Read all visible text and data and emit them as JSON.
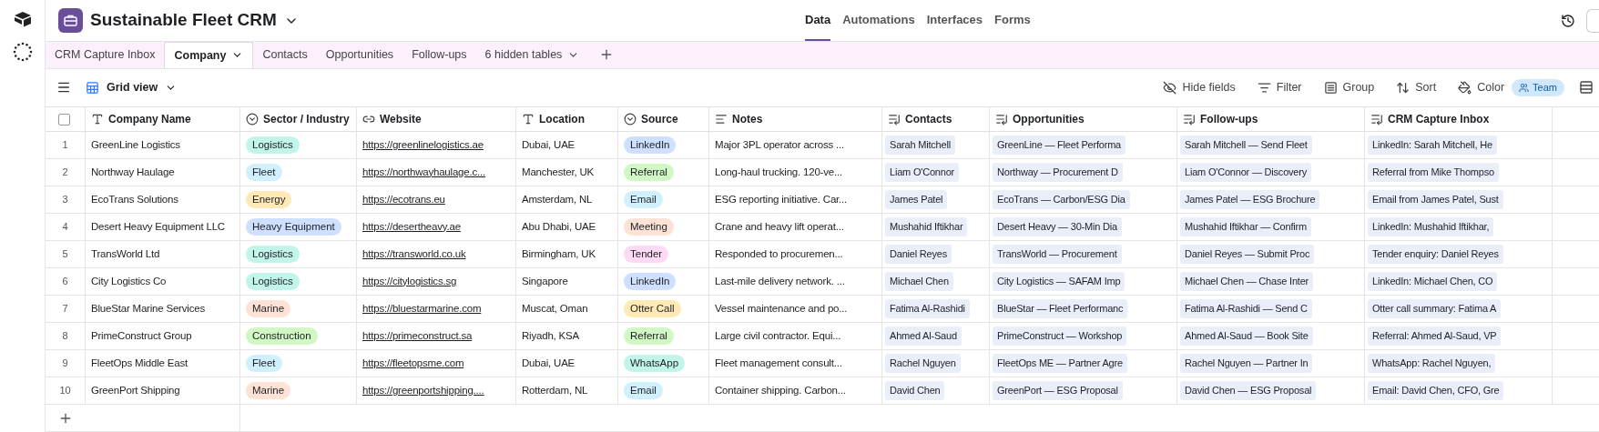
{
  "base": {
    "title": "Sustainable Fleet CRM"
  },
  "nav": [
    {
      "label": "Data",
      "selected": true
    },
    {
      "label": "Automations",
      "selected": false
    },
    {
      "label": "Interfaces",
      "selected": false
    },
    {
      "label": "Forms",
      "selected": false
    }
  ],
  "tables": [
    {
      "label": "CRM Capture Inbox",
      "selected": false
    },
    {
      "label": "Company",
      "selected": true
    },
    {
      "label": "Contacts",
      "selected": false
    },
    {
      "label": "Opportunities",
      "selected": false
    },
    {
      "label": "Follow-ups",
      "selected": false
    }
  ],
  "hidden_tables": "6 hidden tables",
  "view": {
    "name": "Grid view"
  },
  "select_all": {
    "checked": false
  },
  "toolbar": [
    {
      "label": "Hide fields",
      "kind": "hide"
    },
    {
      "label": "Filter",
      "kind": "filter"
    },
    {
      "label": "Group",
      "kind": "group"
    },
    {
      "label": "Sort",
      "kind": "sort"
    },
    {
      "label": "Color",
      "kind": "color",
      "badge": "Team"
    }
  ],
  "columns": [
    {
      "label": "Company Name",
      "kind": "text"
    },
    {
      "label": "Sector / Industry",
      "kind": "select"
    },
    {
      "label": "Website",
      "kind": "url"
    },
    {
      "label": "Location",
      "kind": "text"
    },
    {
      "label": "Source",
      "kind": "select"
    },
    {
      "label": "Notes",
      "kind": "longtext"
    },
    {
      "label": "Contacts",
      "kind": "link"
    },
    {
      "label": "Opportunities",
      "kind": "link"
    },
    {
      "label": "Follow-ups",
      "kind": "link"
    },
    {
      "label": "CRM Capture Inbox",
      "kind": "link"
    }
  ],
  "rows": [
    {
      "number": "1",
      "cells": [
        "GreenLine Logistics",
        {
          "label": "Logistics",
          "color": "#c2f5e9"
        },
        "https://greenlinelogistics.ae",
        "Dubai, UAE",
        {
          "label": "LinkedIn",
          "color": "#cfdfff"
        },
        "Major 3PL operator across ...",
        "Sarah Mitchell",
        "GreenLine — Fleet Performa",
        "Sarah Mitchell — Send Fleet",
        "LinkedIn: Sarah Mitchell, He"
      ]
    },
    {
      "number": "2",
      "cells": [
        "Northway Haulage",
        {
          "label": "Fleet",
          "color": "#d0f0fd"
        },
        "https://northwayhaulage.c...",
        "Manchester, UK",
        {
          "label": "Referral",
          "color": "#d1f7c4"
        },
        "Long-haul trucking. 120-ve...",
        "Liam O'Connor",
        "Northway — Procurement D",
        "Liam O'Connor — Discovery",
        "Referral from Mike Thompso"
      ]
    },
    {
      "number": "3",
      "cells": [
        "EcoTrans Solutions",
        {
          "label": "Energy",
          "color": "#ffeab6"
        },
        "https://ecotrans.eu",
        "Amsterdam, NL",
        {
          "label": "Email",
          "color": "#d0f0fd"
        },
        "ESG reporting initiative. Car...",
        "James Patel",
        "EcoTrans — Carbon/ESG Dia",
        "James Patel — ESG Brochure",
        "Email from James Patel, Sust"
      ]
    },
    {
      "number": "4",
      "cells": [
        "Desert Heavy Equipment LLC",
        {
          "label": "Heavy Equipment",
          "color": "#cfdfff"
        },
        "https://desertheavy.ae",
        "Abu Dhabi, UAE",
        {
          "label": "Meeting",
          "color": "#fee2d5"
        },
        "Crane and heavy lift operat...",
        "Mushahid Iftikhar",
        "Desert Heavy — 30-Min Dia",
        "Mushahid Iftikhar — Confirm",
        "LinkedIn: Mushahid Iftikhar,"
      ]
    },
    {
      "number": "5",
      "cells": [
        "TransWorld Ltd",
        {
          "label": "Logistics",
          "color": "#c2f5e9"
        },
        "https://transworld.co.uk",
        "Birmingham, UK",
        {
          "label": "Tender",
          "color": "#ffdaf6"
        },
        "Responded to procuremen...",
        "Daniel Reyes",
        "TransWorld — Procurement",
        "Daniel Reyes — Submit Proc",
        "Tender enquiry: Daniel Reyes"
      ]
    },
    {
      "number": "6",
      "cells": [
        "City Logistics Co",
        {
          "label": "Logistics",
          "color": "#c2f5e9"
        },
        "https://citylogistics.sg",
        "Singapore",
        {
          "label": "LinkedIn",
          "color": "#cfdfff"
        },
        "Last-mile delivery network. ...",
        "Michael Chen",
        "City Logistics — SAFAM Imp",
        "Michael Chen — Chase Inter",
        "LinkedIn: Michael Chen, CO"
      ]
    },
    {
      "number": "7",
      "cells": [
        "BlueStar Marine Services",
        {
          "label": "Marine",
          "color": "#fee2d5"
        },
        "https://bluestarmarine.com",
        "Muscat, Oman",
        {
          "label": "Otter Call",
          "color": "#ffeab6"
        },
        "Vessel maintenance and po...",
        "Fatima Al-Rashidi",
        "BlueStar — Fleet Performanc",
        "Fatima Al-Rashidi — Send C",
        "Otter call summary: Fatima A"
      ]
    },
    {
      "number": "8",
      "cells": [
        "PrimeConstruct Group",
        {
          "label": "Construction",
          "color": "#d1f7c4"
        },
        "https://primeconstruct.sa",
        "Riyadh, KSA",
        {
          "label": "Referral",
          "color": "#d1f7c4"
        },
        "Large civil contractor. Equi...",
        "Ahmed Al-Saud",
        "PrimeConstruct — Workshop",
        "Ahmed Al-Saud — Book Site",
        "Referral: Ahmed Al-Saud, VP"
      ]
    },
    {
      "number": "9",
      "cells": [
        "FleetOps Middle East",
        {
          "label": "Fleet",
          "color": "#d0f0fd"
        },
        "https://fleetopsme.com",
        "Dubai, UAE",
        {
          "label": "WhatsApp",
          "color": "#c2f5e9"
        },
        "Fleet management consult...",
        "Rachel Nguyen",
        "FleetOps ME — Partner Agre",
        "Rachel Nguyen — Partner In",
        "WhatsApp: Rachel Nguyen,"
      ]
    },
    {
      "number": "10",
      "cells": [
        "GreenPort Shipping",
        {
          "label": "Marine",
          "color": "#fee2d5"
        },
        "https://greenportshipping....",
        "Rotterdam, NL",
        {
          "label": "Email",
          "color": "#d0f0fd"
        },
        "Container shipping. Carbon...",
        "David Chen",
        "GreenPort — ESG Proposal",
        "David Chen — ESG Proposal",
        "Email: David Chen, CFO, Gre"
      ]
    }
  ]
}
